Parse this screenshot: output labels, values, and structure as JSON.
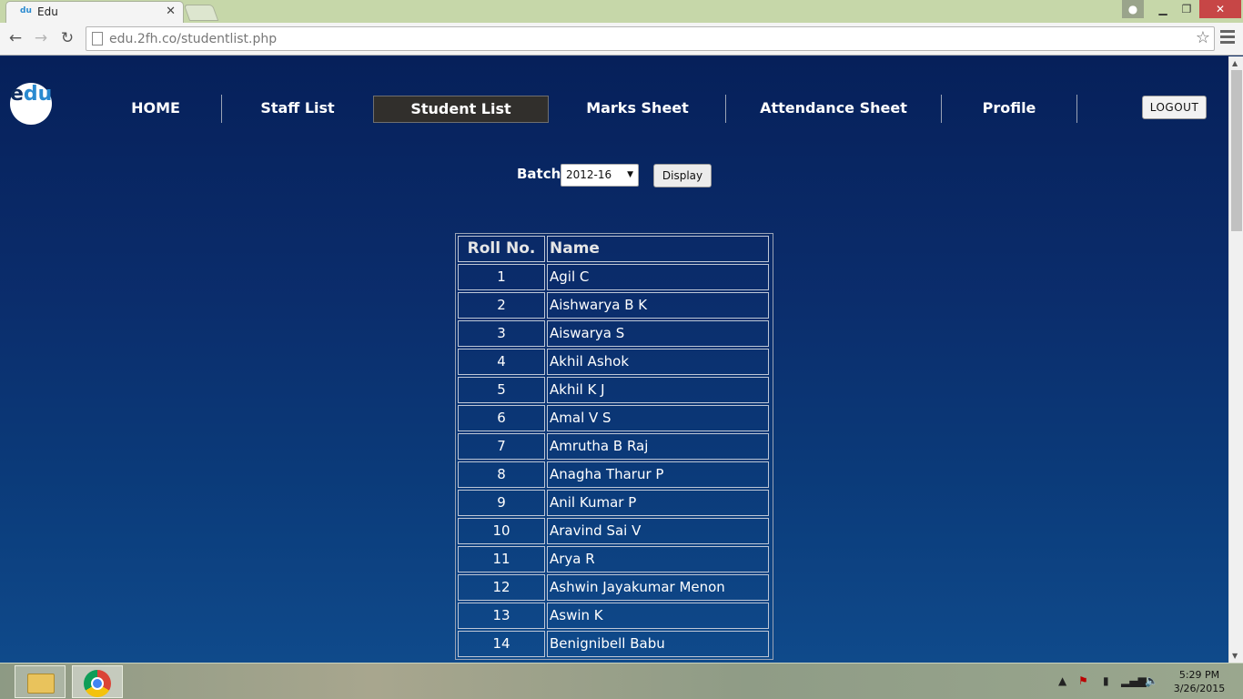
{
  "browser": {
    "tab_title": "Edu",
    "favicon_text": "du",
    "url_host": "edu.2fh.co",
    "url_path": "/studentlist.php"
  },
  "site": {
    "logo_text_dark": "e",
    "logo_text_light": "du",
    "nav": [
      {
        "label": "HOME"
      },
      {
        "label": "Staff List"
      },
      {
        "label": "Student List"
      },
      {
        "label": "Marks Sheet"
      },
      {
        "label": "Attendance Sheet"
      },
      {
        "label": "Profile"
      }
    ],
    "logout_label": "LOGOUT"
  },
  "filter": {
    "batch_label": "Batch",
    "batch_value": "2012-16",
    "display_label": "Display"
  },
  "table": {
    "headers": [
      "Roll No.",
      "Name"
    ],
    "rows": [
      [
        "1",
        "Agil C"
      ],
      [
        "2",
        "Aishwarya B K"
      ],
      [
        "3",
        "Aiswarya S"
      ],
      [
        "4",
        "Akhil Ashok"
      ],
      [
        "5",
        "Akhil K J"
      ],
      [
        "6",
        "Amal V S"
      ],
      [
        "7",
        "Amrutha B Raj"
      ],
      [
        "8",
        "Anagha Tharur P"
      ],
      [
        "9",
        "Anil Kumar P"
      ],
      [
        "10",
        "Aravind Sai V"
      ],
      [
        "11",
        "Arya R"
      ],
      [
        "12",
        "Ashwin Jayakumar Menon"
      ],
      [
        "13",
        "Aswin K"
      ],
      [
        "14",
        "Benignibell Babu"
      ]
    ]
  },
  "taskbar": {
    "time": "5:29 PM",
    "date": "3/26/2015"
  },
  "colors": {
    "page_bg": "#0b2d6c",
    "active_nav_bg": "#312f2c",
    "taskbar_bg": "#9aa78e"
  }
}
